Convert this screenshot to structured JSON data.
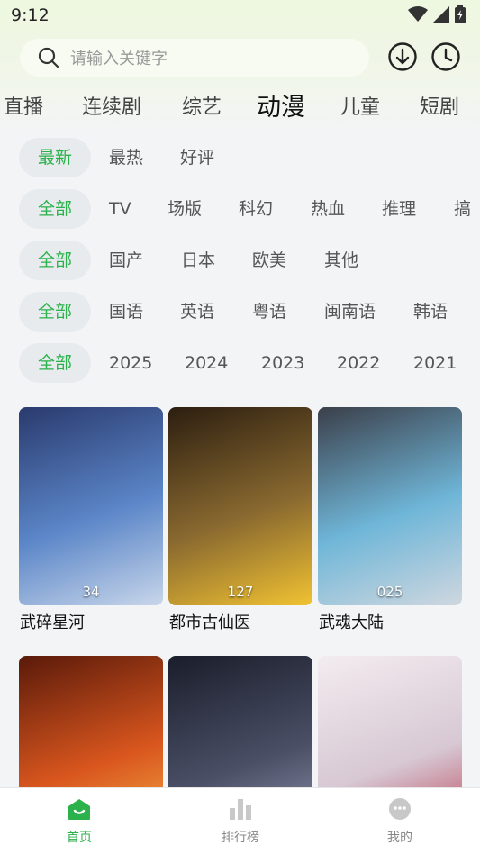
{
  "status": {
    "time": "9:12"
  },
  "search": {
    "placeholder": "请输入关键字"
  },
  "categories": [
    "直播",
    "连续剧",
    "综艺",
    "动漫",
    "儿童",
    "短剧"
  ],
  "active_category": "动漫",
  "filters": {
    "sort": [
      "最新",
      "最热",
      "好评"
    ],
    "genre": [
      "全部",
      "TV",
      "场版",
      "科幻",
      "热血",
      "推理",
      "搞笑"
    ],
    "region": [
      "全部",
      "国产",
      "日本",
      "欧美",
      "其他"
    ],
    "language": [
      "全部",
      "国语",
      "英语",
      "粤语",
      "闽南语",
      "韩语"
    ],
    "year": [
      "全部",
      "2025",
      "2024",
      "2023",
      "2022",
      "2021"
    ]
  },
  "cards": [
    {
      "title": "武碎星河",
      "episode": "34",
      "colors": [
        "#2a3a6e",
        "#5b86c8",
        "#c8d6ea"
      ]
    },
    {
      "title": "都市古仙医",
      "episode": "127",
      "colors": [
        "#2c1e10",
        "#8a6a30",
        "#f1c232"
      ]
    },
    {
      "title": "武魂大陆",
      "episode": "025",
      "colors": [
        "#3b3f4a",
        "#6fb6d8",
        "#cfd7df"
      ]
    },
    {
      "title": "",
      "episode": "",
      "colors": [
        "#5a1a0a",
        "#d9561e",
        "#f7b94a"
      ]
    },
    {
      "title": "",
      "episode": "",
      "colors": [
        "#1a1d2a",
        "#4a4f66",
        "#9aa0b8"
      ]
    },
    {
      "title": "",
      "episode": "",
      "colors": [
        "#f3ecef",
        "#d7c8d4",
        "#b42a3e"
      ]
    }
  ],
  "bottom_nav": [
    {
      "label": "首页",
      "icon": "home-icon"
    },
    {
      "label": "排行榜",
      "icon": "chart-icon"
    },
    {
      "label": "我的",
      "icon": "profile-icon"
    }
  ],
  "accent_color": "#2bb24c"
}
